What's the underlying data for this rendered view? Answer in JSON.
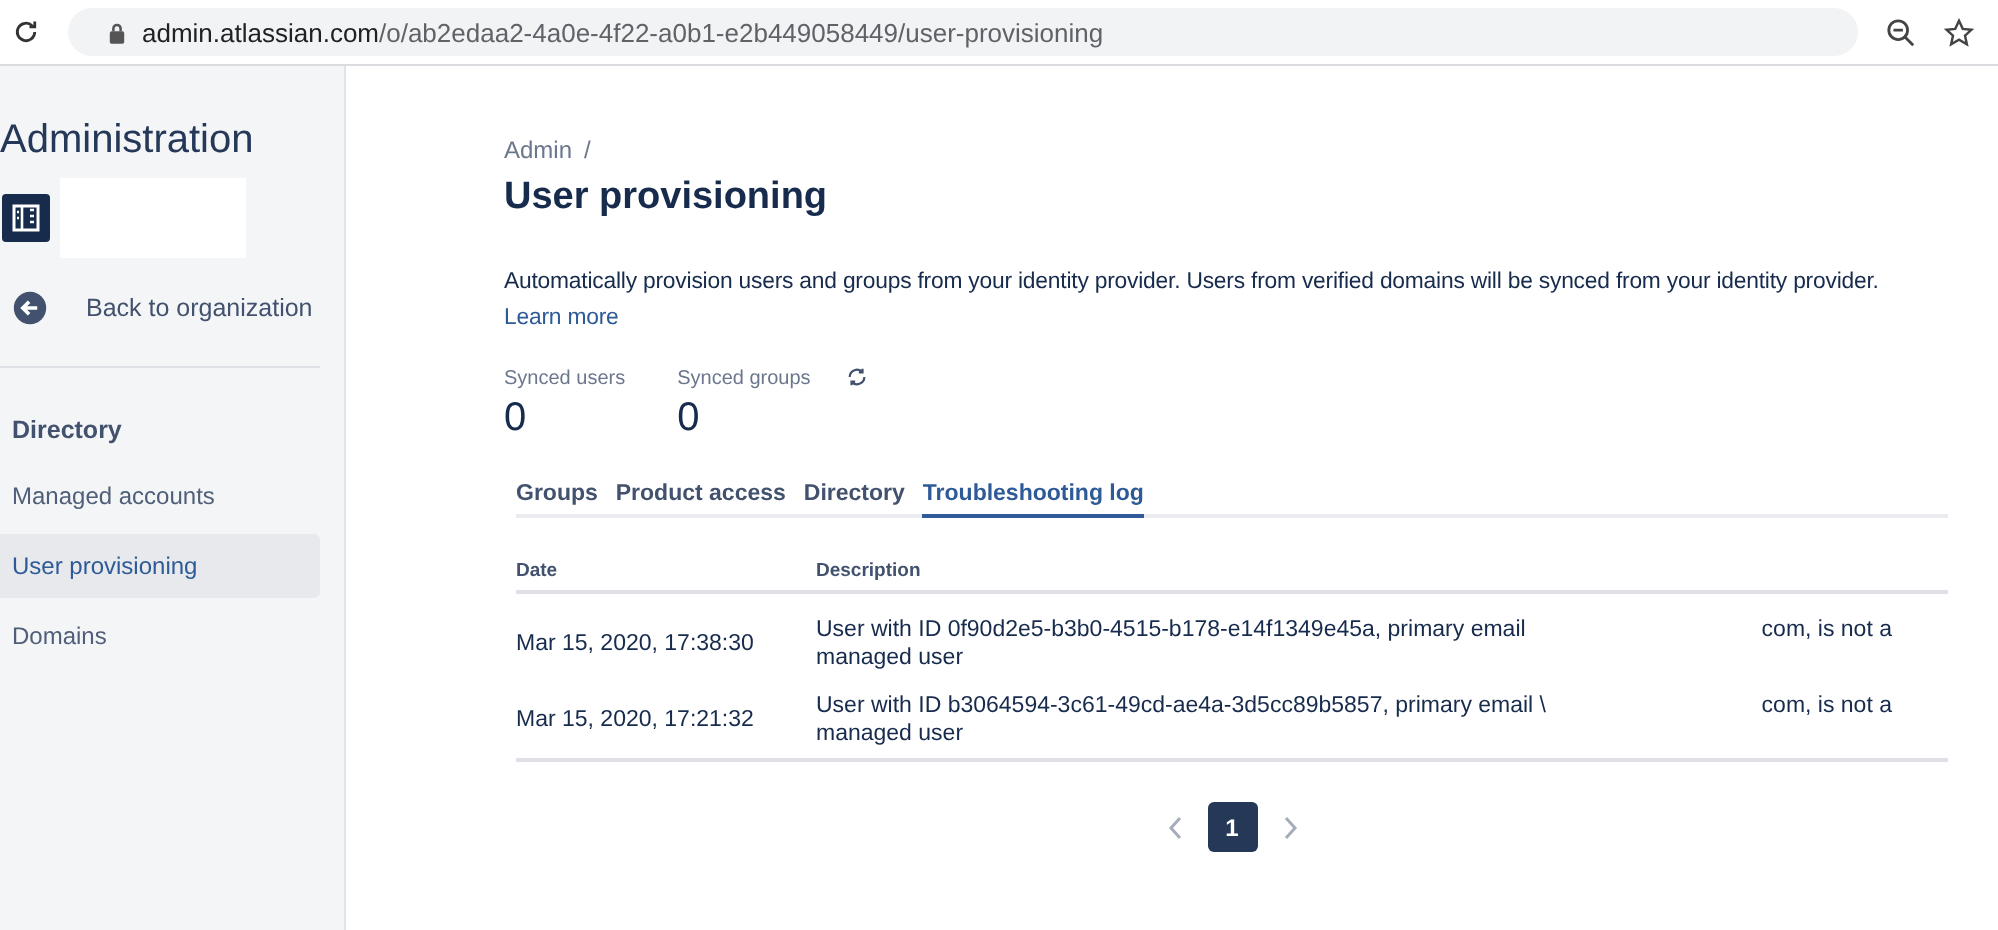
{
  "browser": {
    "url_host": "admin.atlassian.com",
    "url_path": "/o/ab2edaa2-4a0e-4f22-a0b1-e2b449058449/user-provisioning"
  },
  "sidebar": {
    "title": "Administration",
    "back_link": "Back to organization",
    "section": "Directory",
    "items": [
      {
        "label": "Managed accounts",
        "selected": false
      },
      {
        "label": "User provisioning",
        "selected": true
      },
      {
        "label": "Domains",
        "selected": false
      }
    ]
  },
  "breadcrumb": "Admin",
  "breadcrumb_separator": "/",
  "page_title": "User provisioning",
  "description": "Automatically provision users and groups from your identity provider. Users from verified domains will be synced from your identity provider.",
  "learn_more": "Learn more",
  "stats": [
    {
      "label": "Synced users",
      "value": "0"
    },
    {
      "label": "Synced groups",
      "value": "0"
    }
  ],
  "tabs": [
    {
      "label": "Groups",
      "selected": false
    },
    {
      "label": "Product access",
      "selected": false
    },
    {
      "label": "Directory",
      "selected": false
    },
    {
      "label": "Troubleshooting log",
      "selected": true
    }
  ],
  "table": {
    "columns": [
      "Date",
      "Description"
    ],
    "rows": [
      {
        "date": "Mar 15, 2020, 17:38:30",
        "description_start": "User with ID 0f90d2e5-b3b0-4515-b178-e14f1349e45a, primary email",
        "description_end": "com, is not a",
        "description_line2": "managed user"
      },
      {
        "date": "Mar 15, 2020, 17:21:32",
        "description_start": "User with ID b3064594-3c61-49cd-ae4a-3d5cc89b5857, primary email \\",
        "description_end": "com, is not a",
        "description_line2": "managed user"
      }
    ]
  },
  "pagination": {
    "pages": [
      {
        "label": "1",
        "selected": true
      }
    ]
  }
}
